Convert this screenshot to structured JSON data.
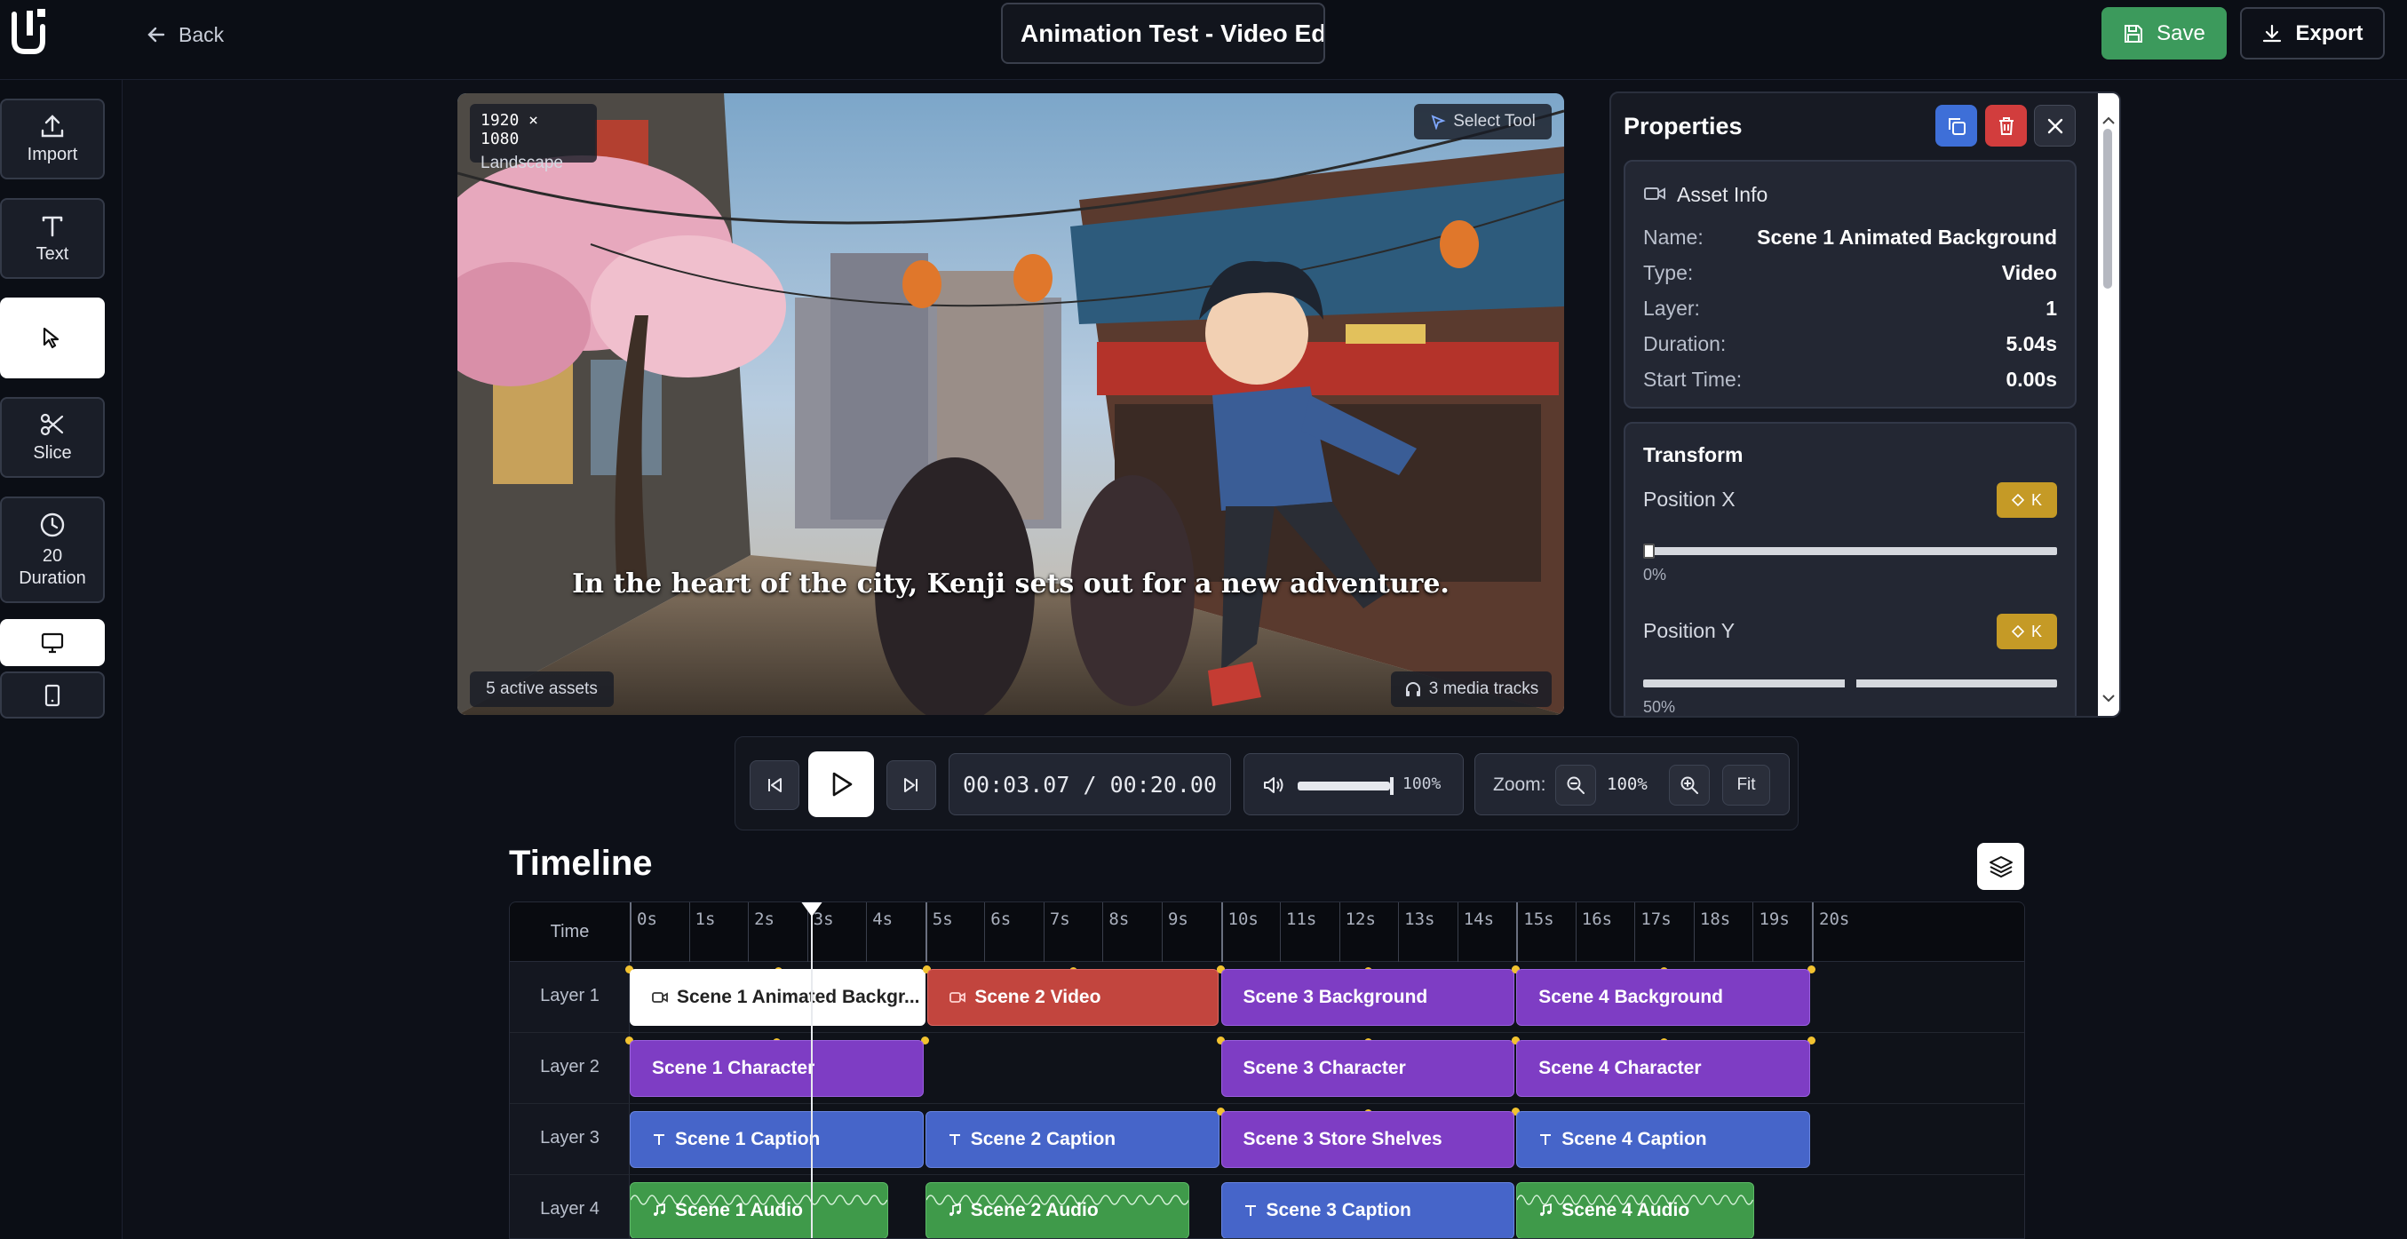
{
  "header": {
    "back_label": "Back",
    "project_title": "Animation Test - Video Editor",
    "save_label": "Save",
    "export_label": "Export"
  },
  "sidebar": {
    "import_label": "Import",
    "text_label": "Text",
    "slice_label": "Slice",
    "duration_value": "20",
    "duration_label": "Duration"
  },
  "preview": {
    "resolution": "1920 × 1080",
    "orientation": "Landscape",
    "tool_label": "Select Tool",
    "caption": "In the heart of the city, Kenji sets out for a new adventure.",
    "assets_badge": "5 active assets",
    "tracks_badge": "3 media tracks"
  },
  "properties": {
    "title": "Properties",
    "asset_info": {
      "heading": "Asset Info",
      "name_label": "Name:",
      "name_value": "Scene 1 Animated Background",
      "type_label": "Type:",
      "type_value": "Video",
      "layer_label": "Layer:",
      "layer_value": "1",
      "duration_label": "Duration:",
      "duration_value": "5.04s",
      "start_label": "Start Time:",
      "start_value": "0.00s"
    },
    "transform": {
      "heading": "Transform",
      "pos_x_label": "Position X",
      "pos_x_value": "0%",
      "pos_x_fraction": 0.0,
      "pos_y_label": "Position Y",
      "pos_y_value": "50%",
      "pos_y_fraction": 0.5,
      "keyframe_label": "K"
    }
  },
  "player": {
    "current_time": "00:03.07",
    "total_time": "00:20.00",
    "time_display": "00:03.07 / 00:20.00",
    "volume_label": "100%",
    "volume_fraction": 1.0,
    "zoom_label": "Zoom:",
    "zoom_value": "100%",
    "fit_label": "Fit"
  },
  "timeline": {
    "title": "Timeline",
    "time_header": "Time",
    "ticks": [
      "0s",
      "1s",
      "2s",
      "3s",
      "4s",
      "5s",
      "6s",
      "7s",
      "8s",
      "9s",
      "10s",
      "11s",
      "12s",
      "13s",
      "14s",
      "15s",
      "16s",
      "17s",
      "18s",
      "19s",
      "20s"
    ],
    "playhead_seconds": 3.07,
    "layers": [
      {
        "label": "Layer 1",
        "clips": [
          {
            "name": "Scene 1 Animated Background",
            "display": "Scene 1 Animated Backgr...",
            "start": 0,
            "end": 5.04,
            "color": "white",
            "icon": "video-icon"
          },
          {
            "name": "Scene 2 Video",
            "display": "Scene 2 Video",
            "start": 5.04,
            "end": 10,
            "color": "red",
            "icon": "video-icon"
          },
          {
            "name": "Scene 3 Background",
            "display": "Scene 3 Background",
            "start": 10,
            "end": 15,
            "color": "purple",
            "icon": ""
          },
          {
            "name": "Scene 4 Background",
            "display": "Scene 4 Background",
            "start": 15,
            "end": 20,
            "color": "purple",
            "icon": ""
          }
        ]
      },
      {
        "label": "Layer 2",
        "clips": [
          {
            "name": "Scene 1 Character",
            "display": "Scene 1 Character",
            "start": 0,
            "end": 5,
            "color": "purple",
            "icon": ""
          },
          {
            "name": "Scene 3 Character",
            "display": "Scene 3 Character",
            "start": 10,
            "end": 15,
            "color": "purple",
            "icon": ""
          },
          {
            "name": "Scene 4 Character",
            "display": "Scene 4 Character",
            "start": 15,
            "end": 20,
            "color": "purple",
            "icon": ""
          }
        ]
      },
      {
        "label": "Layer 3",
        "clips": [
          {
            "name": "Scene 1 Caption",
            "display": "Scene 1 Caption",
            "start": 0,
            "end": 5,
            "color": "blue",
            "icon": "text-icon"
          },
          {
            "name": "Scene 2 Caption",
            "display": "Scene 2 Caption",
            "start": 5,
            "end": 10,
            "color": "blue",
            "icon": "text-icon"
          },
          {
            "name": "Scene 3 Store Shelves",
            "display": "Scene 3 Store Shelves",
            "start": 10,
            "end": 15,
            "color": "purple",
            "icon": ""
          },
          {
            "name": "Scene 4 Caption",
            "display": "Scene 4 Caption",
            "start": 15,
            "end": 20,
            "color": "blue",
            "icon": "text-icon"
          }
        ]
      },
      {
        "label": "Layer 4",
        "clips": [
          {
            "name": "Scene 1 Audio",
            "display": "Scene 1 Audio",
            "start": 0,
            "end": 4.4,
            "color": "green",
            "icon": "music-icon"
          },
          {
            "name": "Scene 2 Audio",
            "display": "Scene 2 Audio",
            "start": 5,
            "end": 9.5,
            "color": "green",
            "icon": "music-icon"
          },
          {
            "name": "Scene 3 Caption",
            "display": "Scene 3 Caption",
            "start": 10,
            "end": 15,
            "color": "blue",
            "icon": "text-icon"
          },
          {
            "name": "Scene 4 Audio",
            "display": "Scene 4 Audio",
            "start": 15,
            "end": 19.05,
            "color": "green",
            "icon": "music-icon"
          }
        ]
      }
    ]
  }
}
